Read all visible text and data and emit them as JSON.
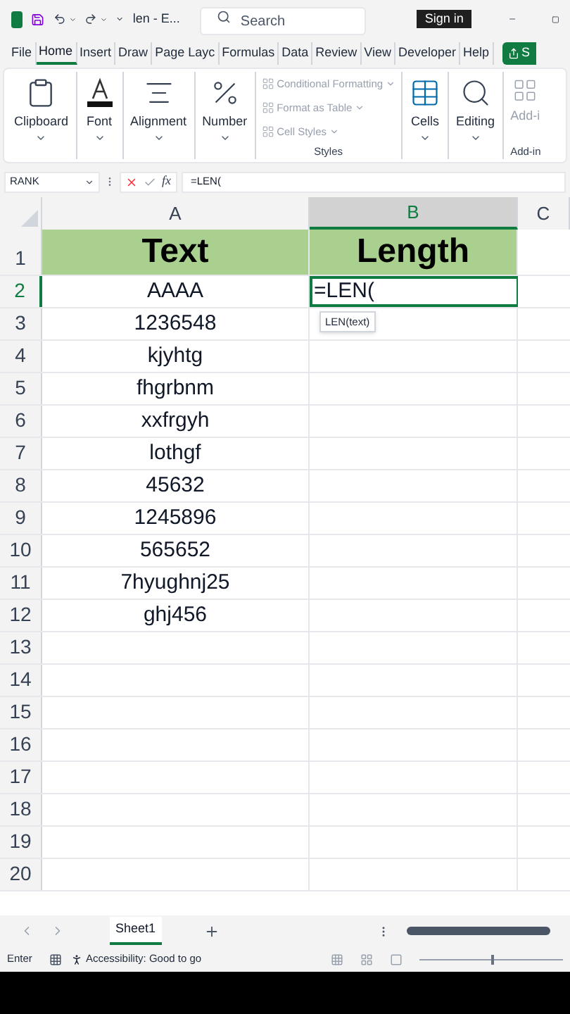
{
  "title_bar": {
    "document": "len - E...",
    "search": {
      "placeholder": "Search"
    },
    "sign_in": "Sign in"
  },
  "tabs": [
    {
      "label": "File",
      "selected": false
    },
    {
      "label": "Home",
      "selected": true
    },
    {
      "label": "Insert",
      "selected": false
    },
    {
      "label": "Draw",
      "selected": false
    },
    {
      "label": "Page Layc",
      "selected": false
    },
    {
      "label": "Formulas",
      "selected": false
    },
    {
      "label": "Data",
      "selected": false
    },
    {
      "label": "Review",
      "selected": false
    },
    {
      "label": "View",
      "selected": false
    },
    {
      "label": "Developer",
      "selected": false
    },
    {
      "label": "Help",
      "selected": false
    }
  ],
  "share_button": "S",
  "ribbon": {
    "groups": [
      {
        "kind": "big",
        "label": "Clipboard"
      },
      {
        "kind": "big",
        "label": "Font"
      },
      {
        "kind": "big",
        "label": "Alignment"
      },
      {
        "kind": "big",
        "label": "Number"
      },
      {
        "kind": "styles",
        "label": "Styles",
        "items": [
          {
            "label": "Conditional Formatting",
            "disabled": true
          },
          {
            "label": "Format as Table",
            "disabled": true
          },
          {
            "label": "Cell Styles",
            "disabled": true
          }
        ]
      },
      {
        "kind": "big",
        "label": "Cells"
      },
      {
        "kind": "big",
        "label": "Editing"
      },
      {
        "kind": "addin",
        "label": "Add-i",
        "caption": "Add-in"
      }
    ]
  },
  "formula_bar": {
    "name_box": "RANK",
    "function_label": "fx",
    "formula": "=LEN("
  },
  "columns": [
    {
      "label": "A",
      "selected": false
    },
    {
      "label": "B",
      "selected": true
    },
    {
      "label": "C",
      "selected": false
    }
  ],
  "rows": [
    {
      "number": "1",
      "selected": false,
      "cells": [
        "Text",
        "Length"
      ],
      "header": true
    },
    {
      "number": "2",
      "selected": true,
      "cells": [
        "AAAA",
        "=LEN("
      ],
      "header": false
    },
    {
      "number": "3",
      "selected": false,
      "cells": [
        "1236548",
        ""
      ],
      "header": false
    },
    {
      "number": "4",
      "selected": false,
      "cells": [
        "kjyhtg",
        ""
      ],
      "header": false
    },
    {
      "number": "5",
      "selected": false,
      "cells": [
        "fhgrbnm",
        ""
      ],
      "header": false
    },
    {
      "number": "6",
      "selected": false,
      "cells": [
        "xxfrgyh",
        ""
      ],
      "header": false
    },
    {
      "number": "7",
      "selected": false,
      "cells": [
        "lothgf",
        ""
      ],
      "header": false
    },
    {
      "number": "8",
      "selected": false,
      "cells": [
        "45632",
        ""
      ],
      "header": false
    },
    {
      "number": "9",
      "selected": false,
      "cells": [
        "1245896",
        ""
      ],
      "header": false
    },
    {
      "number": "10",
      "selected": false,
      "cells": [
        "565652",
        ""
      ],
      "header": false
    },
    {
      "number": "11",
      "selected": false,
      "cells": [
        "7hyughnj25",
        ""
      ],
      "header": false
    },
    {
      "number": "12",
      "selected": false,
      "cells": [
        "ghj456",
        ""
      ],
      "header": false
    },
    {
      "number": "13",
      "selected": false,
      "cells": [
        "",
        ""
      ],
      "header": false
    },
    {
      "number": "14",
      "selected": false,
      "cells": [
        "",
        ""
      ],
      "header": false
    },
    {
      "number": "15",
      "selected": false,
      "cells": [
        "",
        ""
      ],
      "header": false
    },
    {
      "number": "16",
      "selected": false,
      "cells": [
        "",
        ""
      ],
      "header": false
    },
    {
      "number": "17",
      "selected": false,
      "cells": [
        "",
        ""
      ],
      "header": false
    },
    {
      "number": "18",
      "selected": false,
      "cells": [
        "",
        ""
      ],
      "header": false
    },
    {
      "number": "19",
      "selected": false,
      "cells": [
        "",
        ""
      ],
      "header": false
    },
    {
      "number": "20",
      "selected": false,
      "cells": [
        "",
        ""
      ],
      "header": false
    }
  ],
  "tooltip": "LEN(text)",
  "sheets": [
    {
      "label": "Sheet1",
      "selected": true
    }
  ],
  "status_bar": {
    "mode": "Enter",
    "accessibility": "Accessibility: Good to go",
    "zoom": {
      "level": 0.5
    }
  }
}
